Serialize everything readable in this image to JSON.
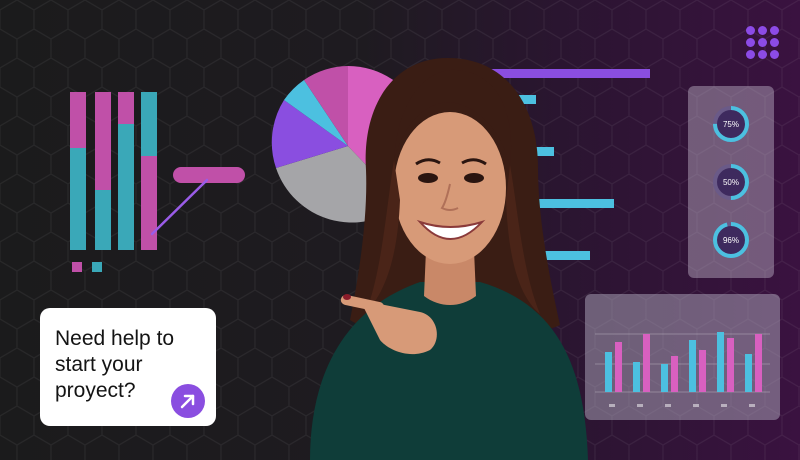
{
  "cta": {
    "text": "Need help to\nstart your\nproyect?",
    "button_icon": "arrow-up-right-icon"
  },
  "gauges": [
    {
      "label": "75%",
      "value": 0.75
    },
    {
      "label": "50%",
      "value": 0.5
    },
    {
      "label": "96%",
      "value": 0.96
    }
  ],
  "menu_icon": "grid-menu-icon",
  "colors": {
    "magenta": "#c050a8",
    "teal": "#3aa8b8",
    "purple": "#8a4ee0",
    "cyan": "#4cc0e0",
    "gray": "#a5a5a8",
    "pink": "#d860c0"
  }
}
